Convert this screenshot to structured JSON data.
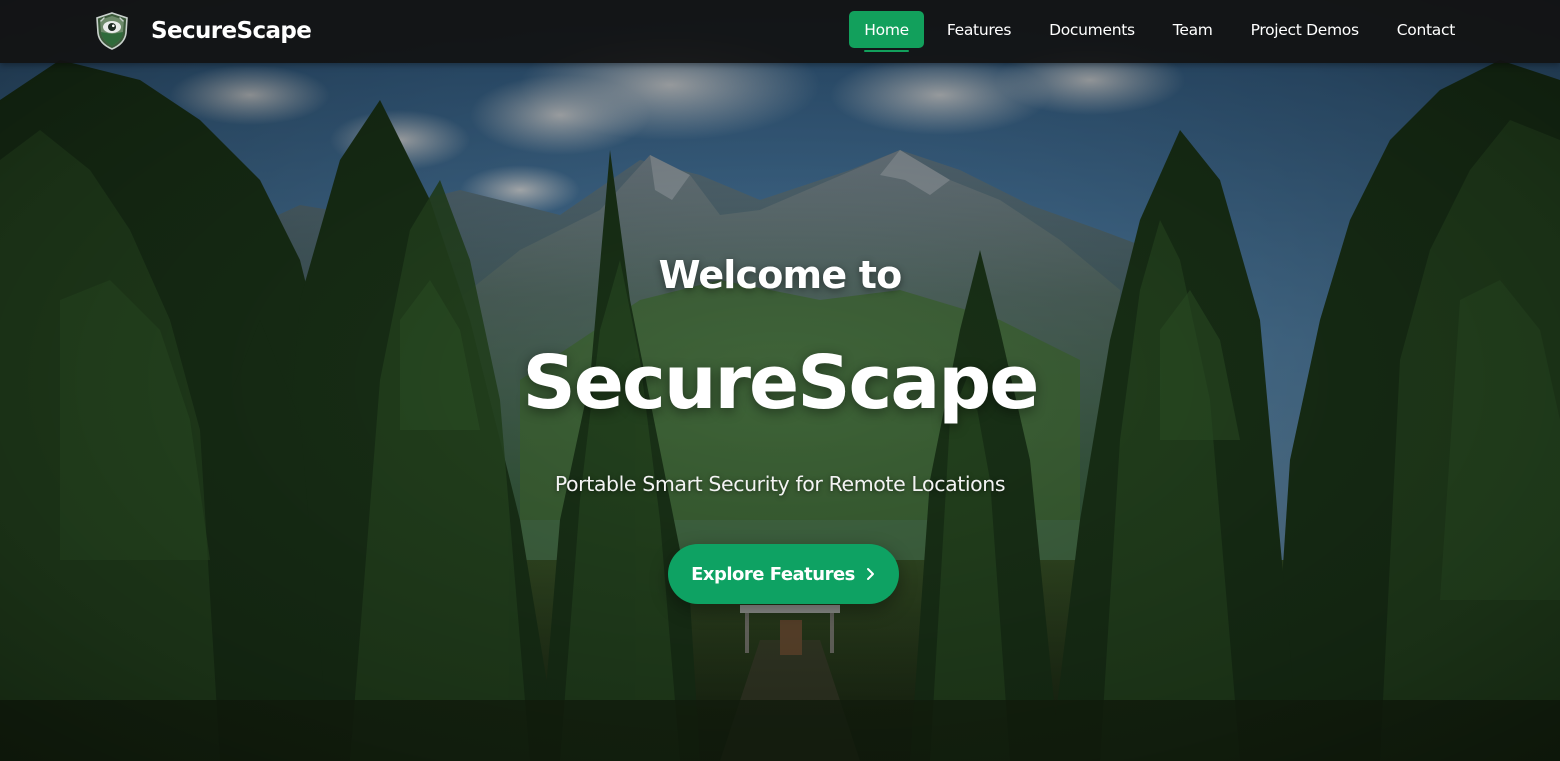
{
  "brand": {
    "name": "SecureScape",
    "logo_icon": "shield-eye-logo"
  },
  "nav": {
    "items": [
      {
        "label": "Home",
        "active": true
      },
      {
        "label": "Features",
        "active": false
      },
      {
        "label": "Documents",
        "active": false
      },
      {
        "label": "Team",
        "active": false
      },
      {
        "label": "Project Demos",
        "active": false
      },
      {
        "label": "Contact",
        "active": false
      }
    ]
  },
  "hero": {
    "welcome": "Welcome to",
    "title": "SecureScape",
    "tagline": "Portable Smart Security for Remote Locations",
    "cta_label": "Explore Features",
    "cta_icon": "chevron-right-icon"
  },
  "colors": {
    "accent": "#0ea263",
    "navbar_bg": "#121212",
    "text": "#ffffff"
  }
}
